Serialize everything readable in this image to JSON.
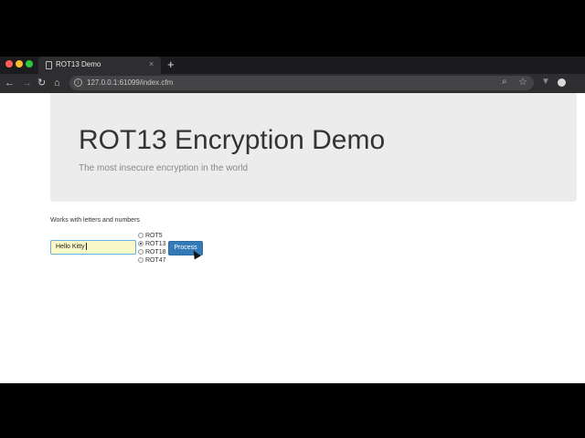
{
  "browser": {
    "tab_title": "ROT13 Demo",
    "tab_close": "×",
    "new_tab": "+",
    "url": "127.0.0.1:61099/index.cfm",
    "nav": {
      "back": "←",
      "forward": "→",
      "reload": "↻",
      "home": "⌂"
    }
  },
  "page": {
    "title": "ROT13 Encryption Demo",
    "subtitle": "The most insecure encryption in the world",
    "hint": "Works with letters and numbers",
    "input_value": "Hello Kitty",
    "options": [
      {
        "label": "ROT5",
        "checked": false
      },
      {
        "label": "ROT13",
        "checked": true
      },
      {
        "label": "ROT18",
        "checked": false
      },
      {
        "label": "ROT47",
        "checked": false
      }
    ],
    "process_label": "Process"
  },
  "colors": {
    "jumbotron_bg": "#ececec",
    "button_blue": "#337ab7",
    "input_highlight": "#fafac8"
  }
}
